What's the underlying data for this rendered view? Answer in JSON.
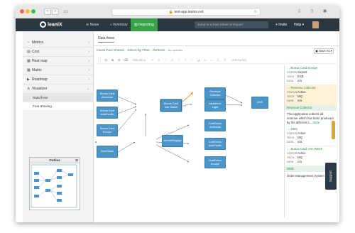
{
  "browser": {
    "url": "test-app.leanix.net",
    "reload_icon": "reload-icon",
    "back_icon": "back-icon",
    "forward_icon": "forward-icon"
  },
  "topbar": {
    "logo": "leanIX",
    "nav": [
      {
        "label": "News",
        "icon": "rss-icon"
      },
      {
        "label": "Inventory",
        "icon": "search-icon"
      },
      {
        "label": "Reporting",
        "icon": "bar-chart-icon",
        "active": true
      }
    ],
    "search_placeholder": "Jump to a Fact Sheet or Report",
    "invite_label": "+ Invite",
    "help_label": "Help ▾",
    "active_color": "#3aa14b",
    "bar_color": "#2a3640"
  },
  "sidebar": {
    "items": [
      {
        "label": "Metrics",
        "icon": "gauge-icon"
      },
      {
        "label": "Cost",
        "icon": "cost-icon"
      },
      {
        "label": "Heat map",
        "icon": "heatmap-icon"
      },
      {
        "label": "Matrix",
        "icon": "matrix-icon"
      },
      {
        "label": "Roadmap",
        "icon": "roadmap-icon"
      },
      {
        "label": "Visualizer",
        "icon": "visualizer-icon"
      }
    ],
    "subitems": [
      {
        "label": "Data flows",
        "selected": true
      },
      {
        "label": "Free drawing",
        "selected": false
      }
    ],
    "outline_title": "Outline"
  },
  "main": {
    "tab": "Data flows",
    "actions": {
      "insert": "Insert Fact Sheets",
      "select": "Select by Filter",
      "refresh": "Refresh",
      "refresh_note": "No updates"
    },
    "save_label": "Save As ▾",
    "toolbar": {
      "font": "Helvetica",
      "horizontal": "Horizontal"
    }
  },
  "diagram": {
    "nodes": [
      {
        "id": "n1",
        "label": "Bonus Card Americas"
      },
      {
        "id": "n2",
        "label": "Bonus Card AsiaPacific"
      },
      {
        "id": "n3",
        "label": "Bonus Card Europe"
      },
      {
        "id": "n4",
        "label": "Bonus Card Use Watch"
      },
      {
        "id": "n5",
        "label": "Revenue Collector"
      },
      {
        "id": "n6",
        "label": "salesforce Light"
      },
      {
        "id": "n7",
        "label": "DMS"
      },
      {
        "id": "n8",
        "label": "StoreTrack"
      },
      {
        "id": "n9",
        "label": "serviceEngage"
      },
      {
        "id": "n10",
        "label": "CustEchoo Americas"
      },
      {
        "id": "n11",
        "label": "CustEchoo AsiaPacific"
      },
      {
        "id": "n12",
        "label": "CustEchoo Europe"
      }
    ]
  },
  "panel": {
    "cards_top": [
      {
        "title": "→ Bonus Card Europe",
        "status": "Sunset",
        "tech": "ESB",
        "data": "n/a",
        "highlight": false
      },
      {
        "title": "→ Revenue Collector",
        "status": "Active",
        "tech": "MQ",
        "data": "n/a",
        "highlight": true
      }
    ],
    "section1_title": "Revenue Collector",
    "section1_desc": "This application collects all revenue which has been produced by the different s...",
    "more_label": "more",
    "cards_bottom": [
      {
        "title": "→ DMS",
        "status": "Active",
        "tech": "MQ",
        "data": "n/a"
      },
      {
        "title": "← Bonus Card Use Watch",
        "status": "Active",
        "tech": "MQ",
        "data": "n/a"
      }
    ],
    "section2_title": "DMS",
    "section2_desc": "Order Management System",
    "labels": {
      "status": "STATUS",
      "tech": "TECH",
      "data": "DATA"
    }
  },
  "support_label": "Support",
  "colors": {
    "node": "#4b95c9",
    "edge_highlight": "#f0a030",
    "link": "#2f8f3e"
  }
}
